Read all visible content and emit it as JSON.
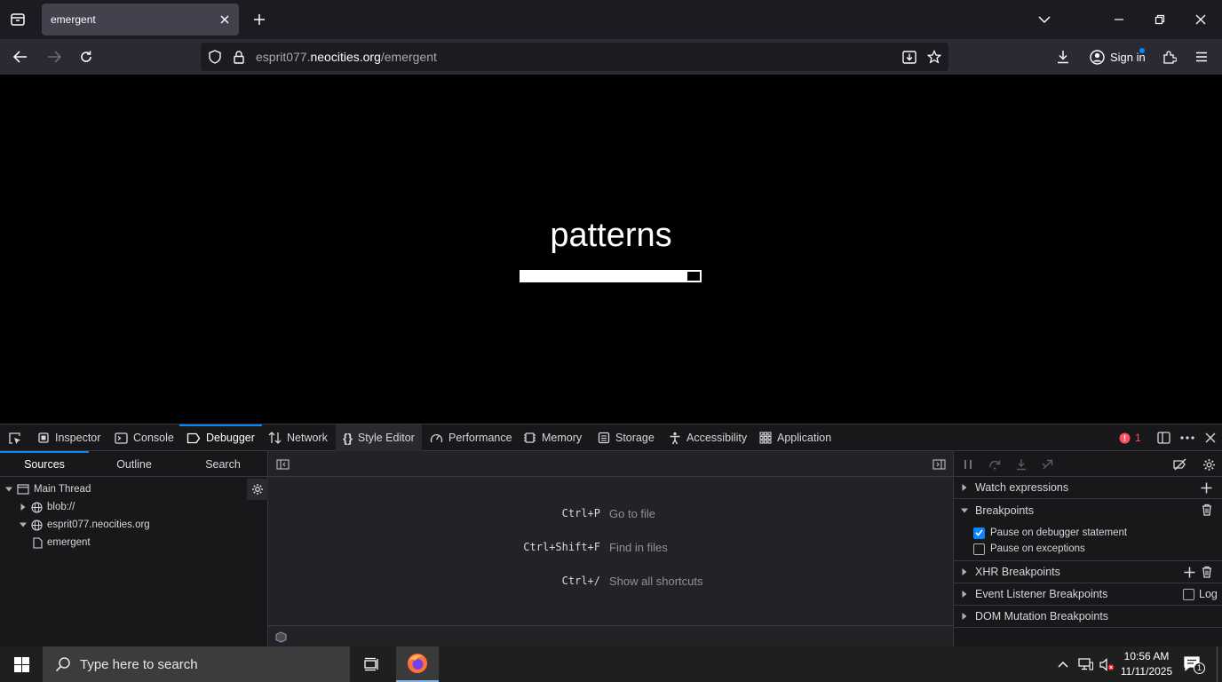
{
  "browser": {
    "tab_title": "emergent",
    "url_prefix": "esprit077.",
    "url_domain": "neocities.org",
    "url_path": "/emergent",
    "sign_in_label": "Sign in"
  },
  "page": {
    "heading": "patterns",
    "progress_fraction": 0.93
  },
  "devtools": {
    "tabs": [
      {
        "label": "Inspector"
      },
      {
        "label": "Console"
      },
      {
        "label": "Debugger"
      },
      {
        "label": "Network"
      },
      {
        "label": "Style Editor"
      },
      {
        "label": "Performance"
      },
      {
        "label": "Memory"
      },
      {
        "label": "Storage"
      },
      {
        "label": "Accessibility"
      },
      {
        "label": "Application"
      }
    ],
    "error_count": "1",
    "sources_tabs": [
      "Sources",
      "Outline",
      "Search"
    ],
    "tree": {
      "main_thread": "Main Thread",
      "blob": "blob://",
      "host": "esprit077.neocities.org",
      "file": "emergent"
    },
    "shortcuts": [
      {
        "key": "Ctrl+P",
        "label": "Go to file"
      },
      {
        "key": "Ctrl+Shift+F",
        "label": "Find in files"
      },
      {
        "key": "Ctrl+/",
        "label": "Show all shortcuts"
      }
    ],
    "right_panel": {
      "watch": "Watch expressions",
      "breakpoints": "Breakpoints",
      "pause_debugger": "Pause on debugger statement",
      "pause_debugger_checked": true,
      "pause_exceptions": "Pause on exceptions",
      "pause_exceptions_checked": false,
      "xhr": "XHR Breakpoints",
      "event_listener": "Event Listener Breakpoints",
      "log_label": "Log",
      "dom_mutation": "DOM Mutation Breakpoints"
    }
  },
  "taskbar": {
    "search_placeholder": "Type here to search",
    "time": "10:56 AM",
    "date": "11/11/2025",
    "notification_count": "1"
  },
  "colors": {
    "accent": "#0a84ff",
    "error": "#ff4f5e",
    "firefox_orange": "#ff7139"
  }
}
